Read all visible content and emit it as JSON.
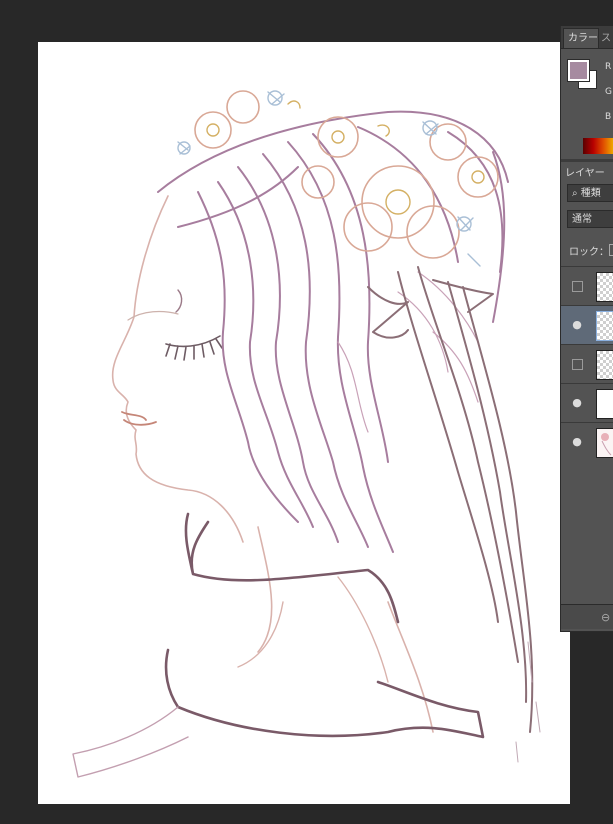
{
  "color_panel": {
    "tab_color": "カラー",
    "tab_swatches": "ス",
    "label_r": "R",
    "label_g": "G",
    "label_b": "B",
    "foreground_color": "#a68aa0",
    "background_color": "#ffffff"
  },
  "layers_panel": {
    "title": "レイヤー",
    "search_placeholder": "種類",
    "blend_mode": "通常",
    "lock_label": "ロック：",
    "layers": [
      {
        "visible": false,
        "thumbnail": "transparent"
      },
      {
        "visible": true,
        "thumbnail": "transparent",
        "selected": true
      },
      {
        "visible": false,
        "thumbnail": "transparent"
      },
      {
        "visible": true,
        "thumbnail": "white"
      },
      {
        "visible": true,
        "thumbnail": "artwork"
      }
    ]
  },
  "icons": {
    "search": "search-icon",
    "eye": "eye-icon",
    "link": "link-icon"
  },
  "canvas": {
    "content": "line-art-profile-portrait"
  }
}
